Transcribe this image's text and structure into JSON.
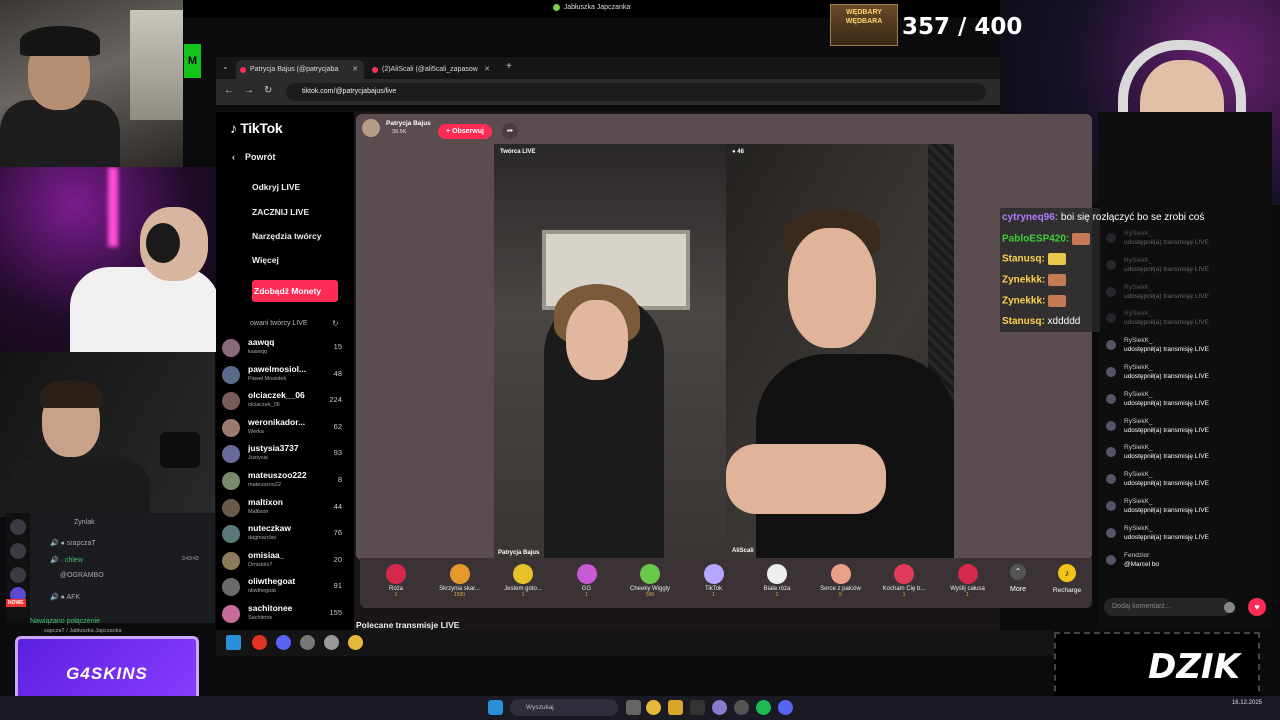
{
  "top_bar": {
    "title": "Jabłuszka Japczanka"
  },
  "counter": {
    "value": "357 / 400",
    "badge": "WĘDBARY WĘDBARA"
  },
  "browser": {
    "tabs": [
      {
        "label": "Patrycja Bajus (@patrycjaba",
        "active": true
      },
      {
        "label": "(2)AliScali (@ali5cali_zapasow"
      }
    ],
    "url": "tiktok.com/@patrycjabajus/live"
  },
  "tiktok_sidebar": {
    "logo": "TikTok",
    "back": "Powrót",
    "menu": [
      "Odkryj LIVE",
      "ZACZNIJ LIVE",
      "Narzędzia twórcy",
      "Więcej"
    ],
    "coins_button": "Zdobądź Monety",
    "suggested_header": "owani twórcy LIVE",
    "suggested": [
      {
        "name": "aawqq",
        "sub": "kaawqq",
        "viewers": "15"
      },
      {
        "name": "pawelmosiol...",
        "sub": "Paweł Mosiołek",
        "viewers": "48"
      },
      {
        "name": "olciaczek__06",
        "sub": "olciaczek_06",
        "viewers": "224"
      },
      {
        "name": "weronikador...",
        "sub": "Werka",
        "viewers": "62"
      },
      {
        "name": "justysia3737",
        "sub": "Justysia",
        "viewers": "93"
      },
      {
        "name": "mateuszoo222",
        "sub": "mateuszoo22",
        "viewers": "8"
      },
      {
        "name": "maltixon",
        "sub": "Maltixon",
        "viewers": "44"
      },
      {
        "name": "nuteczkaw",
        "sub": "dagmarclav",
        "viewers": "76"
      },
      {
        "name": "omisiaa_",
        "sub": "Omisiolo7",
        "viewers": "20"
      },
      {
        "name": "oliwthegoat",
        "sub": "oliwthegoat",
        "viewers": "91"
      },
      {
        "name": "sachitonee",
        "sub": "Sachitone",
        "viewers": "155"
      }
    ]
  },
  "live": {
    "host_name": "Patrycja Bajus",
    "host_followers": "39.5K",
    "follow_button": "+ Obserwuj",
    "panel1_label": "Twórca LIVE",
    "panel1_name": "Patrycja Bajus",
    "panel2_count": "46",
    "panel2_name": "AliScali",
    "gifts": [
      {
        "label": "Róża",
        "cost": "1"
      },
      {
        "label": "Skrzynia skar...",
        "cost": "1500"
      },
      {
        "label": "Jestem goto...",
        "cost": "1"
      },
      {
        "label": "GG",
        "cost": "1"
      },
      {
        "label": "Cheeky Wiggly",
        "cost": "500"
      },
      {
        "label": "TikTok",
        "cost": "1"
      },
      {
        "label": "Biała róża",
        "cost": "1"
      },
      {
        "label": "Serce z palców",
        "cost": "5"
      },
      {
        "label": "Kocham Cię b...",
        "cost": "1"
      },
      {
        "label": "Wyślij całusa",
        "cost": "1"
      }
    ],
    "more_label": "More",
    "recharge_label": "Recharge",
    "recommended_title": "Polecane transmisje LIVE"
  },
  "live_chat": {
    "messages": [
      {
        "name": "RySiekK_",
        "text": "udostępnił(a) transmisję LIVE"
      },
      {
        "name": "RySiekK_",
        "text": "udostępnił(a) transmisję LIVE"
      },
      {
        "name": "RySiekK_",
        "text": "udostępnił(a) transmisję LIVE"
      },
      {
        "name": "RySiekK_",
        "text": "udostępnił(a) transmisję LIVE"
      },
      {
        "name": "RySiekK_",
        "text": "udostępnił(a) transmisję LIVE"
      },
      {
        "name": "RySiekK_",
        "text": "udostępnił(a) transmisję LIVE"
      },
      {
        "name": "RySiekK_",
        "text": "udostępnił(a) transmisję LIVE"
      },
      {
        "name": "RySiekK_",
        "text": "udostępnił(a) transmisję LIVE"
      },
      {
        "name": "RySiekK_",
        "text": "udostępnił(a) transmisję LIVE"
      },
      {
        "name": "RySiekK_",
        "text": "udostępnił(a) transmisję LIVE"
      },
      {
        "name": "RySiekK_",
        "text": "udostępnił(a) transmisję LIVE"
      },
      {
        "name": "RySiekK_",
        "text": "udostępnił(a) transmisję LIVE"
      },
      {
        "name": "Fendzior",
        "text": "@Marcel bo"
      }
    ],
    "placeholder": "Dodaj komentarz..."
  },
  "twitch_chat": [
    {
      "user": "cytryneq96:",
      "text": " boi się rozłączyć bo se zrobi coś",
      "color": "#b57cff"
    },
    {
      "user": "PabloESP420:",
      "text": "",
      "color": "#3ed03e"
    },
    {
      "user": "Stanusq:",
      "text": "",
      "color": "#ffd24a"
    },
    {
      "user": "Zynekkk:",
      "text": "",
      "color": "#ffd24a"
    },
    {
      "user": "Zynekkk:",
      "text": "",
      "color": "#ffd24a"
    },
    {
      "user": "Stanusq:",
      "text": " xddddd",
      "color": "#ffd24a"
    }
  ],
  "discord": {
    "lines": [
      "Zynlak",
      "srapczaT",
      "chlew",
      "@OGRAMBO",
      "AFK"
    ],
    "time": "3:43:43",
    "badge": "NOWE",
    "connected": "Nawiązano połączenie",
    "connected_sub": "sapczaT / Jabłuszka Japczanka"
  },
  "sponsors": {
    "g4": "G4SKINS",
    "dzik": "DZIK"
  },
  "taskbar": {
    "search": "Wyszukaj",
    "clock": "16.12.2025"
  }
}
